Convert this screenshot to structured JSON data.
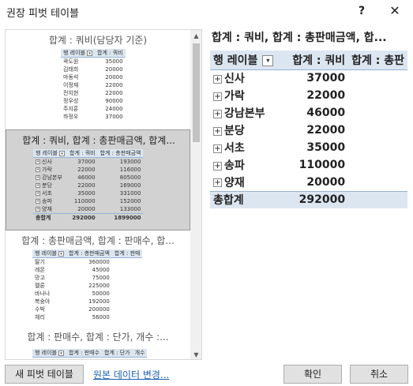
{
  "window": {
    "title": "권장 피벗 테이블",
    "help_label": "?",
    "close_label": "✕"
  },
  "cards": [
    {
      "title": "합계 : 쿼비(담당자 기준)",
      "header": [
        "행 레이블",
        "합계 : 쿼비"
      ],
      "rows": [
        [
          "곽도원",
          "35000"
        ],
        [
          "김태희",
          "20000"
        ],
        [
          "마동석",
          "20000"
        ],
        [
          "이정재",
          "22000"
        ],
        [
          "전지현",
          "22000"
        ],
        [
          "정우성",
          "90000"
        ],
        [
          "주지훈",
          "24000"
        ],
        [
          "하정우",
          "37000"
        ]
      ]
    },
    {
      "title": "합계 : 쿼비, 합계 : 총판매금액, 합계...",
      "header": [
        "행 레이블",
        "합계 : 쿼비",
        "합계 : 총판매금액"
      ],
      "rows": [
        [
          "신사",
          "37000",
          "193000"
        ],
        [
          "가락",
          "22000",
          "116000"
        ],
        [
          "강남본부",
          "46000",
          "805000"
        ],
        [
          "분당",
          "22000",
          "169000"
        ],
        [
          "서초",
          "35000",
          "331000"
        ],
        [
          "송파",
          "110000",
          "152000"
        ],
        [
          "양재",
          "20000",
          "133000"
        ]
      ],
      "total": [
        "총합계",
        "292000",
        "1899000"
      ]
    },
    {
      "title": "합계 : 총판매금액, 합계 : 판매수, 합...",
      "header": [
        "행 레이블",
        "합계 : 총판매금액",
        "합계 : 판매"
      ],
      "rows": [
        [
          "딸기",
          "360000"
        ],
        [
          "레몬",
          "45000"
        ],
        [
          "망고",
          "75000"
        ],
        [
          "멜론",
          "225000"
        ],
        [
          "바나나",
          "50000"
        ],
        [
          "복숭아",
          "192000"
        ],
        [
          "수박",
          "200000"
        ],
        [
          "체리",
          "56000"
        ]
      ]
    },
    {
      "title": "합계 : 판매수, 합계 : 단가, 개수 :...",
      "header": [
        "행 레이블",
        "합계 : 판매수",
        "합계 : 단가",
        "개수"
      ]
    }
  ],
  "preview": {
    "title": "합계 : 쿼비, 합계 : 총판매금액, 합...",
    "header": [
      "행 레이블",
      "합계 : 쿼비",
      "합계 : 총판"
    ],
    "rows": [
      {
        "label": "신사",
        "value": "37000"
      },
      {
        "label": "가락",
        "value": "22000"
      },
      {
        "label": "강남본부",
        "value": "46000"
      },
      {
        "label": "분당",
        "value": "22000"
      },
      {
        "label": "서초",
        "value": "35000"
      },
      {
        "label": "송파",
        "value": "110000"
      },
      {
        "label": "양재",
        "value": "20000"
      }
    ],
    "total": {
      "label": "총합계",
      "value": "292000"
    },
    "expand_symbol": "+"
  },
  "buttons": {
    "new_pivot": "새 피벗 테이블",
    "change_source": "원본 데이터 변경...",
    "ok": "확인",
    "cancel": "취소"
  },
  "colors": {
    "header_fill": "#dce6f1",
    "selected_card": "#d2d2d2",
    "link": "#1a5fb4"
  }
}
